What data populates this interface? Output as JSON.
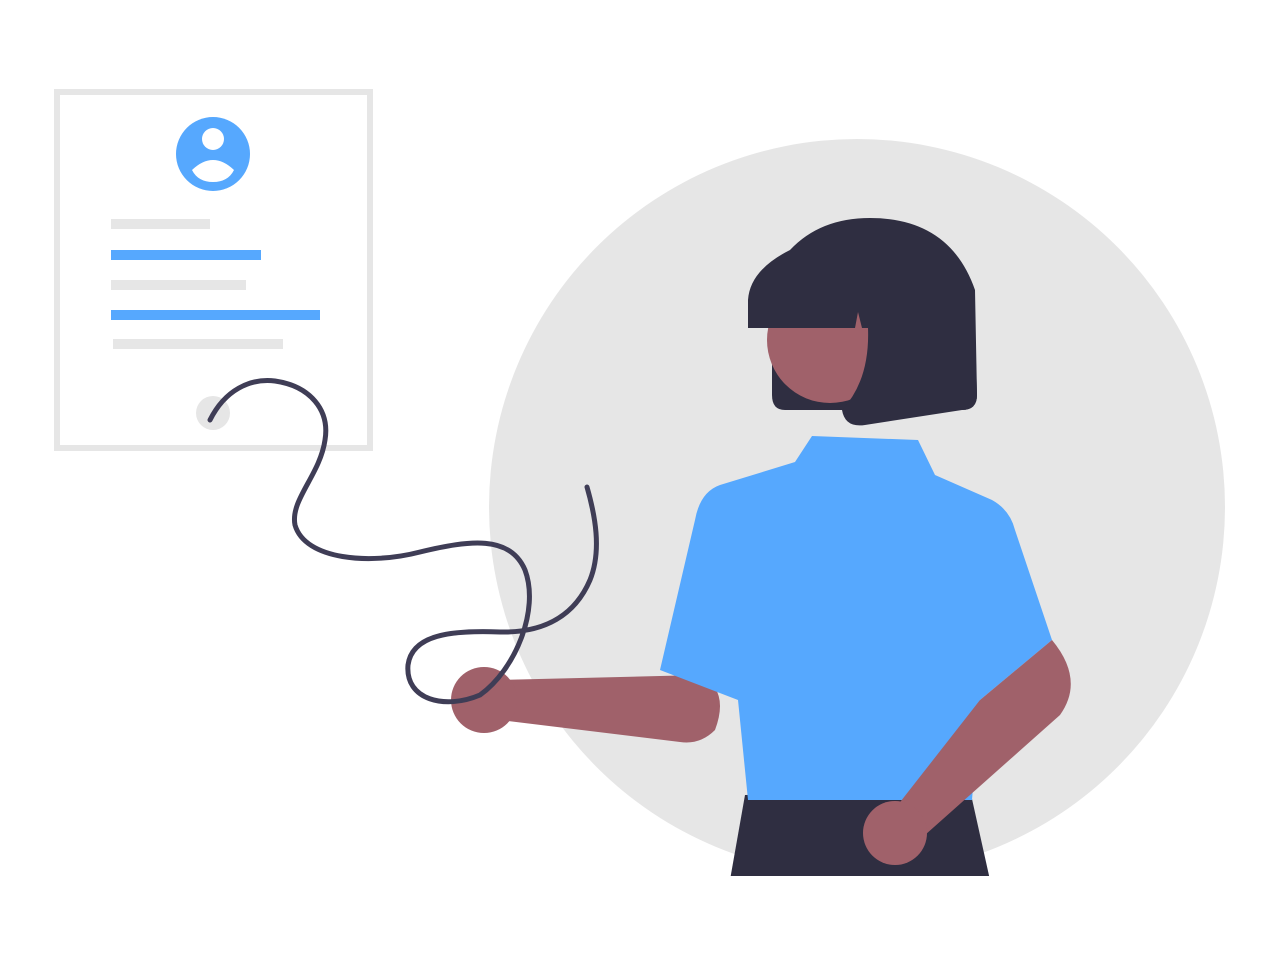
{
  "illustration": {
    "colors": {
      "background": "#ffffff",
      "document_border": "#e6e6e6",
      "placeholder_line": "#e6e6e6",
      "accent": "#56a8fe",
      "backdrop_circle": "#e6e6e6",
      "hair": "#2f2e41",
      "skin": "#a0616a",
      "shirt": "#56a8fe",
      "pants": "#2f2e41",
      "signature": "#3f3d56"
    },
    "icons": [
      "user-avatar-icon"
    ]
  }
}
